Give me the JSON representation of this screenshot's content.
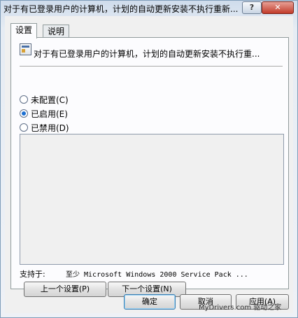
{
  "window": {
    "title": "对于有已登录用户的计算机，计划的自动更新安装不执行重新...",
    "help_glyph": "?",
    "close_glyph": "✕"
  },
  "tabs": [
    {
      "label": "设置",
      "active": true
    },
    {
      "label": "说明",
      "active": false
    }
  ],
  "policy": {
    "name": "对于有已登录用户的计算机，计划的自动更新安装不执行重...",
    "icon": "policy-icon"
  },
  "radios": [
    {
      "label": "未配置(C)",
      "checked": false
    },
    {
      "label": "已启用(E)",
      "checked": true
    },
    {
      "label": "已禁用(D)",
      "checked": false
    }
  ],
  "supported": {
    "label": "支持于:",
    "value": "至少 Microsoft Windows 2000 Service Pack ..."
  },
  "nav": {
    "prev_label": "上一个设置(P)",
    "next_label": "下一个设置(N)"
  },
  "footer": {
    "ok_label": "确定",
    "cancel_label": "取消",
    "apply_label": "应用(A)"
  },
  "watermark": "MyDrivers.com 驱动之家"
}
